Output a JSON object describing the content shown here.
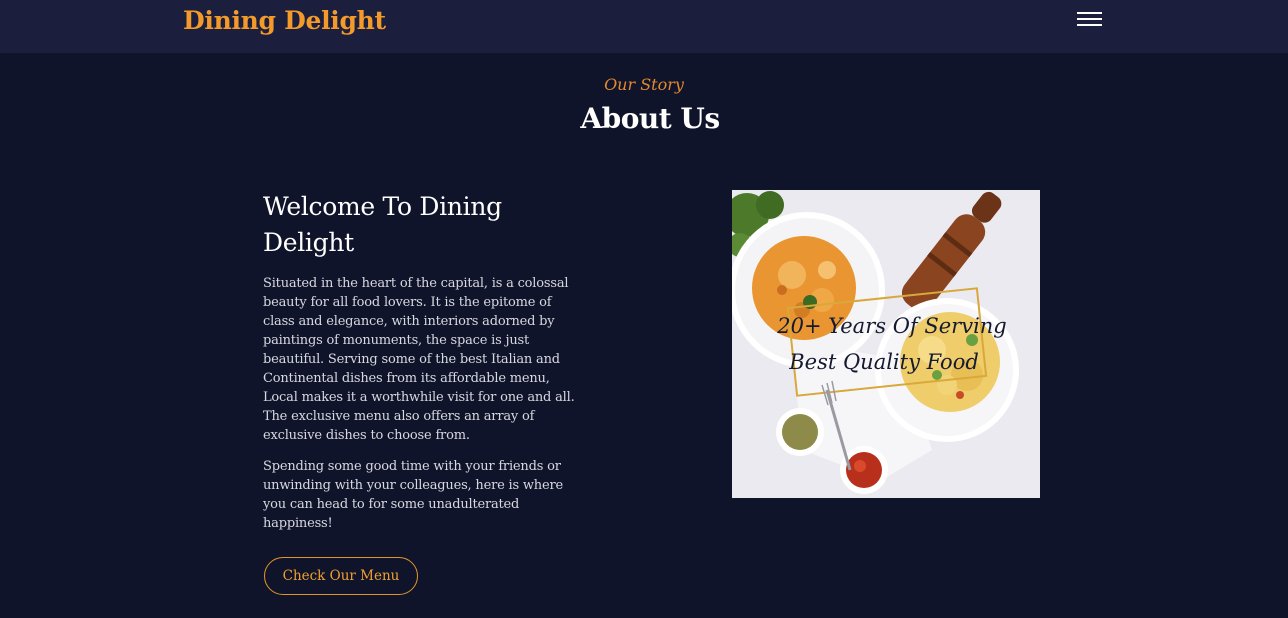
{
  "header": {
    "brand": "Dining Delight",
    "menu_icon": "hamburger-menu-icon"
  },
  "about": {
    "subtitle": "Our Story",
    "title": "About Us",
    "welcome_heading": "Welcome To Dining Delight",
    "paragraph_1": "Situated in the heart of the capital, is a colossal beauty for all food lovers. It is the epitome of class and elegance, with interiors adorned by paintings of monuments, the space is just beautiful. Serving some of the best Italian and Continental dishes from its affordable menu, Local makes it a worthwhile visit for one and all. The exclusive menu also offers an array of exclusive dishes to choose from.",
    "paragraph_2": "Spending some good time with your friends or unwinding with your colleagues, here is where you can head to for some unadulterated happiness!",
    "menu_button": "Check Our Menu"
  },
  "image": {
    "caption_line_1": "20+ Years Of Serving",
    "caption_line_2": "Best Quality Food"
  },
  "colors": {
    "background": "#10142a",
    "navbar": "#1b1f3d",
    "accent": "#f39a2a"
  }
}
